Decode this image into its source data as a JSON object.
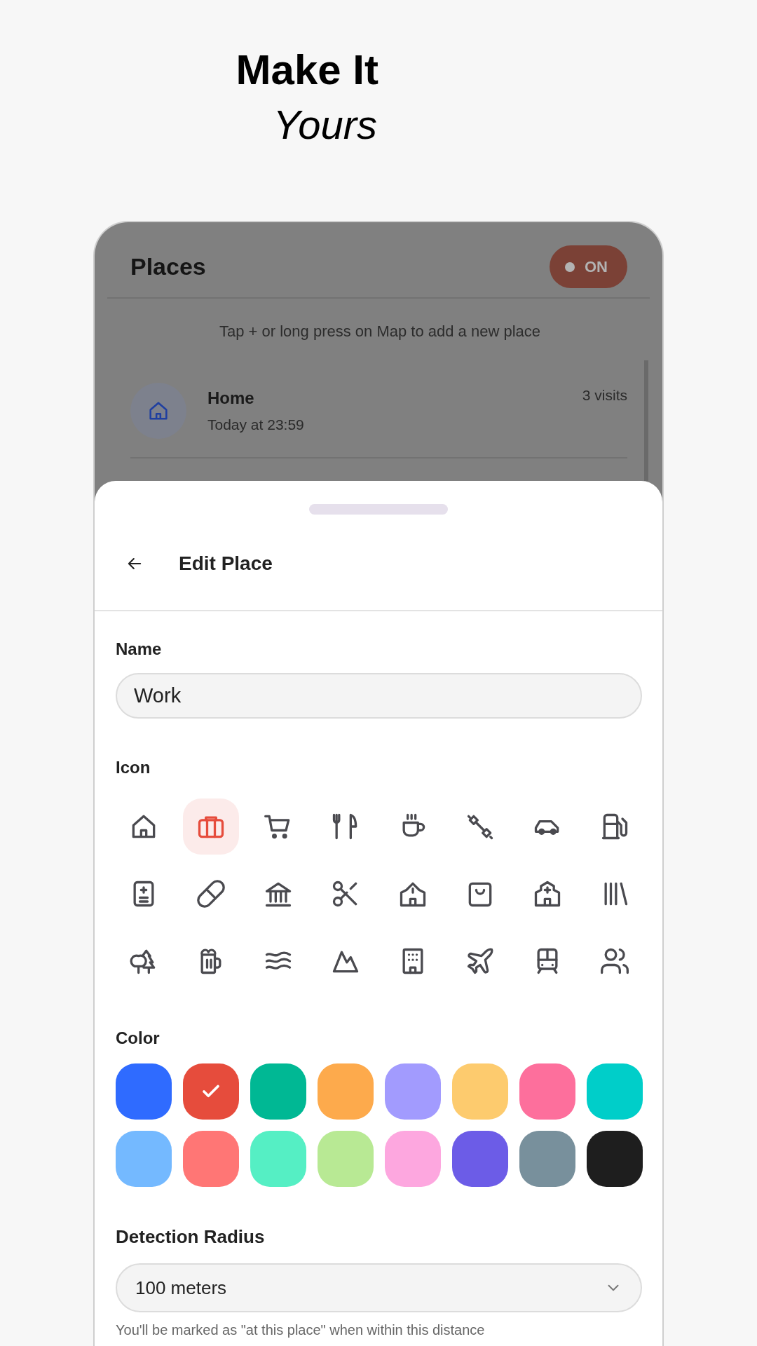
{
  "headline": {
    "line_1": "Make It",
    "line_2": "Yours"
  },
  "background_screen": {
    "title": "Places",
    "toggle": {
      "label": "ON",
      "on": true
    },
    "hint": "Tap + or long press on Map to add a new place",
    "places": [
      {
        "name": "Home",
        "time": "Today at 23:59",
        "visits": "3 visits"
      }
    ]
  },
  "sheet": {
    "title": "Edit Place",
    "name_label": "Name",
    "name_value": "Work",
    "icon_label": "Icon",
    "icons": [
      {
        "selected": false
      },
      {
        "selected": true
      },
      {
        "selected": false
      },
      {
        "selected": false
      },
      {
        "selected": false
      },
      {
        "selected": false
      },
      {
        "selected": false
      },
      {
        "selected": false
      },
      {
        "selected": false
      },
      {
        "selected": false
      },
      {
        "selected": false
      },
      {
        "selected": false
      },
      {
        "selected": false
      },
      {
        "selected": false
      },
      {
        "selected": false
      },
      {
        "selected": false
      },
      {
        "selected": false
      },
      {
        "selected": false
      },
      {
        "selected": false
      },
      {
        "selected": false
      },
      {
        "selected": false
      },
      {
        "selected": false
      },
      {
        "selected": false
      },
      {
        "selected": false
      }
    ],
    "color_label": "Color",
    "colors": [
      {
        "color": "#2f6bff",
        "selected": false
      },
      {
        "color": "#e64c3c",
        "selected": true
      },
      {
        "color": "#00b894",
        "selected": false
      },
      {
        "color": "#fdaa4c",
        "selected": false
      },
      {
        "color": "#a29bfe",
        "selected": false
      },
      {
        "color": "#fdcb6e",
        "selected": false
      },
      {
        "color": "#fd6f9c",
        "selected": false
      },
      {
        "color": "#00cec9",
        "selected": false
      },
      {
        "color": "#74b9ff",
        "selected": false
      },
      {
        "color": "#ff7675",
        "selected": false
      },
      {
        "color": "#55efc4",
        "selected": false
      },
      {
        "color": "#b8e994",
        "selected": false
      },
      {
        "color": "#fda7df",
        "selected": false
      },
      {
        "color": "#6c5ce7",
        "selected": false
      },
      {
        "color": "#78909c",
        "selected": false
      },
      {
        "color": "#1e1e1e",
        "selected": false
      }
    ],
    "radius_label": "Detection Radius",
    "radius_value": "100 meters",
    "radius_help": "You'll be marked as \"at this place\" when within this distance"
  }
}
